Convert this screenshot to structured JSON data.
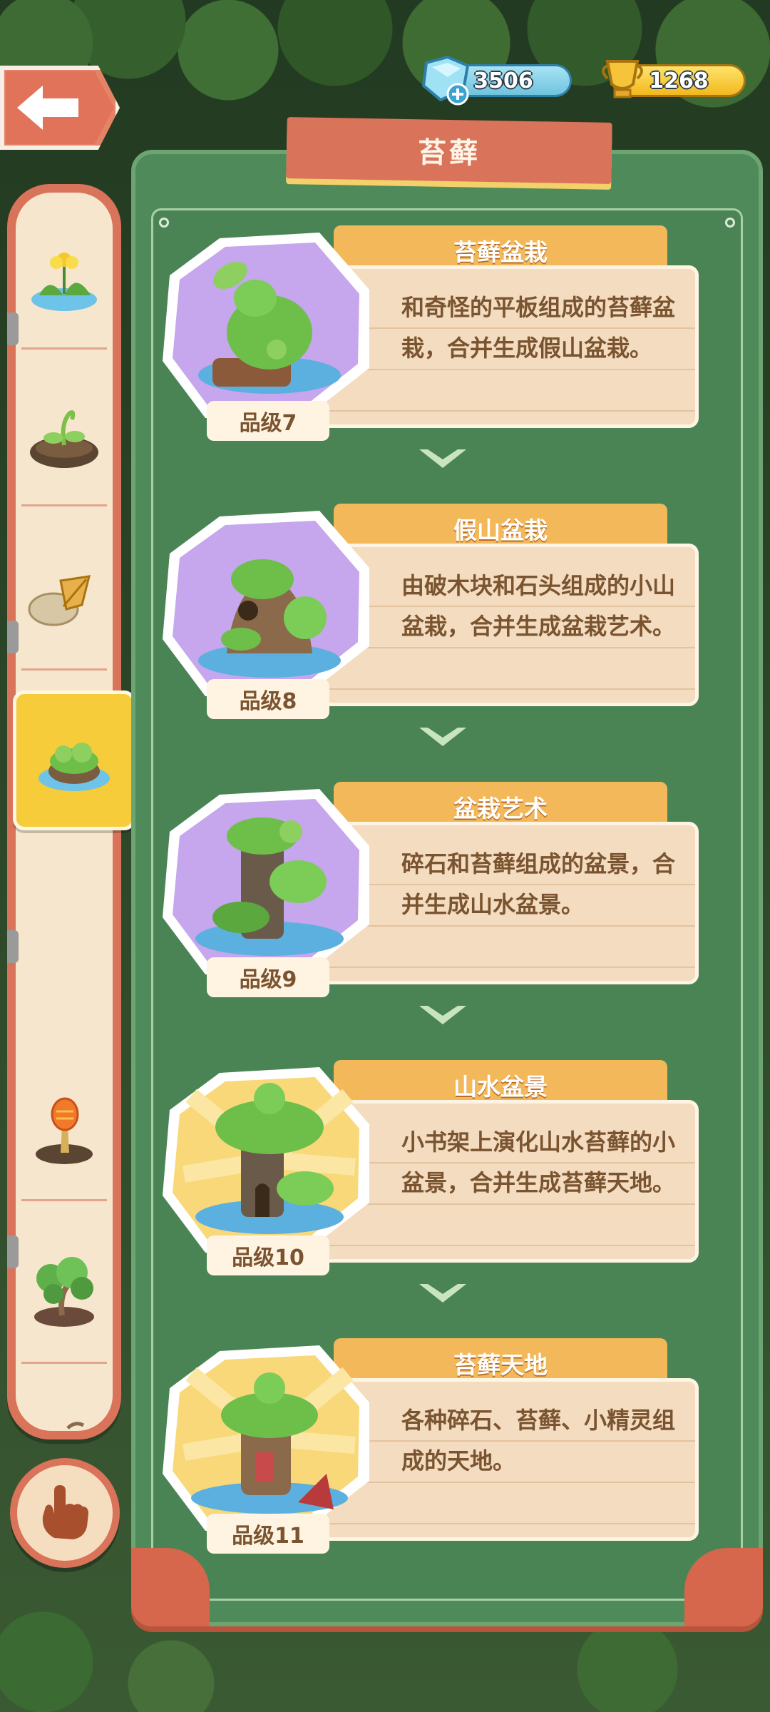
{
  "header": {
    "gems": "3506",
    "gold": "1268"
  },
  "panel": {
    "title": "苔藓"
  },
  "categories": [
    {
      "icon": "yellow-flower-icon"
    },
    {
      "icon": "sprout-icon"
    },
    {
      "icon": "rock-leaf-icon"
    },
    {
      "icon": "moss-icon",
      "selected": true
    },
    {
      "icon": "torch-plant-icon"
    },
    {
      "icon": "bonsai-tree-icon"
    },
    {
      "icon": "grape-icon"
    },
    {
      "icon": "grass-icon"
    }
  ],
  "items": [
    {
      "name": "苔藓盆栽",
      "grade": "品级7",
      "desc": "和奇怪的平板组成的苔藓盆栽，合并生成假山盆栽。",
      "bg": "purple"
    },
    {
      "name": "假山盆栽",
      "grade": "品级8",
      "desc": "由破木块和石头组成的小山盆栽，合并生成盆栽艺术。",
      "bg": "purple"
    },
    {
      "name": "盆栽艺术",
      "grade": "品级9",
      "desc": "碎石和苔藓组成的盆景，合并生成山水盆景。",
      "bg": "purple"
    },
    {
      "name": "山水盆景",
      "grade": "品级10",
      "desc": "小书架上演化山水苔藓的小盆景，合并生成苔藓天地。",
      "bg": "gold"
    },
    {
      "name": "苔藓天地",
      "grade": "品级11",
      "desc": "各种碎石、苔藓、小精灵组成的天地。",
      "bg": "gold"
    }
  ],
  "colors": {
    "accent": "#d9735a",
    "panel": "#4f8a5a",
    "tab": "#f2b85a",
    "desc_text": "#7a5430"
  }
}
